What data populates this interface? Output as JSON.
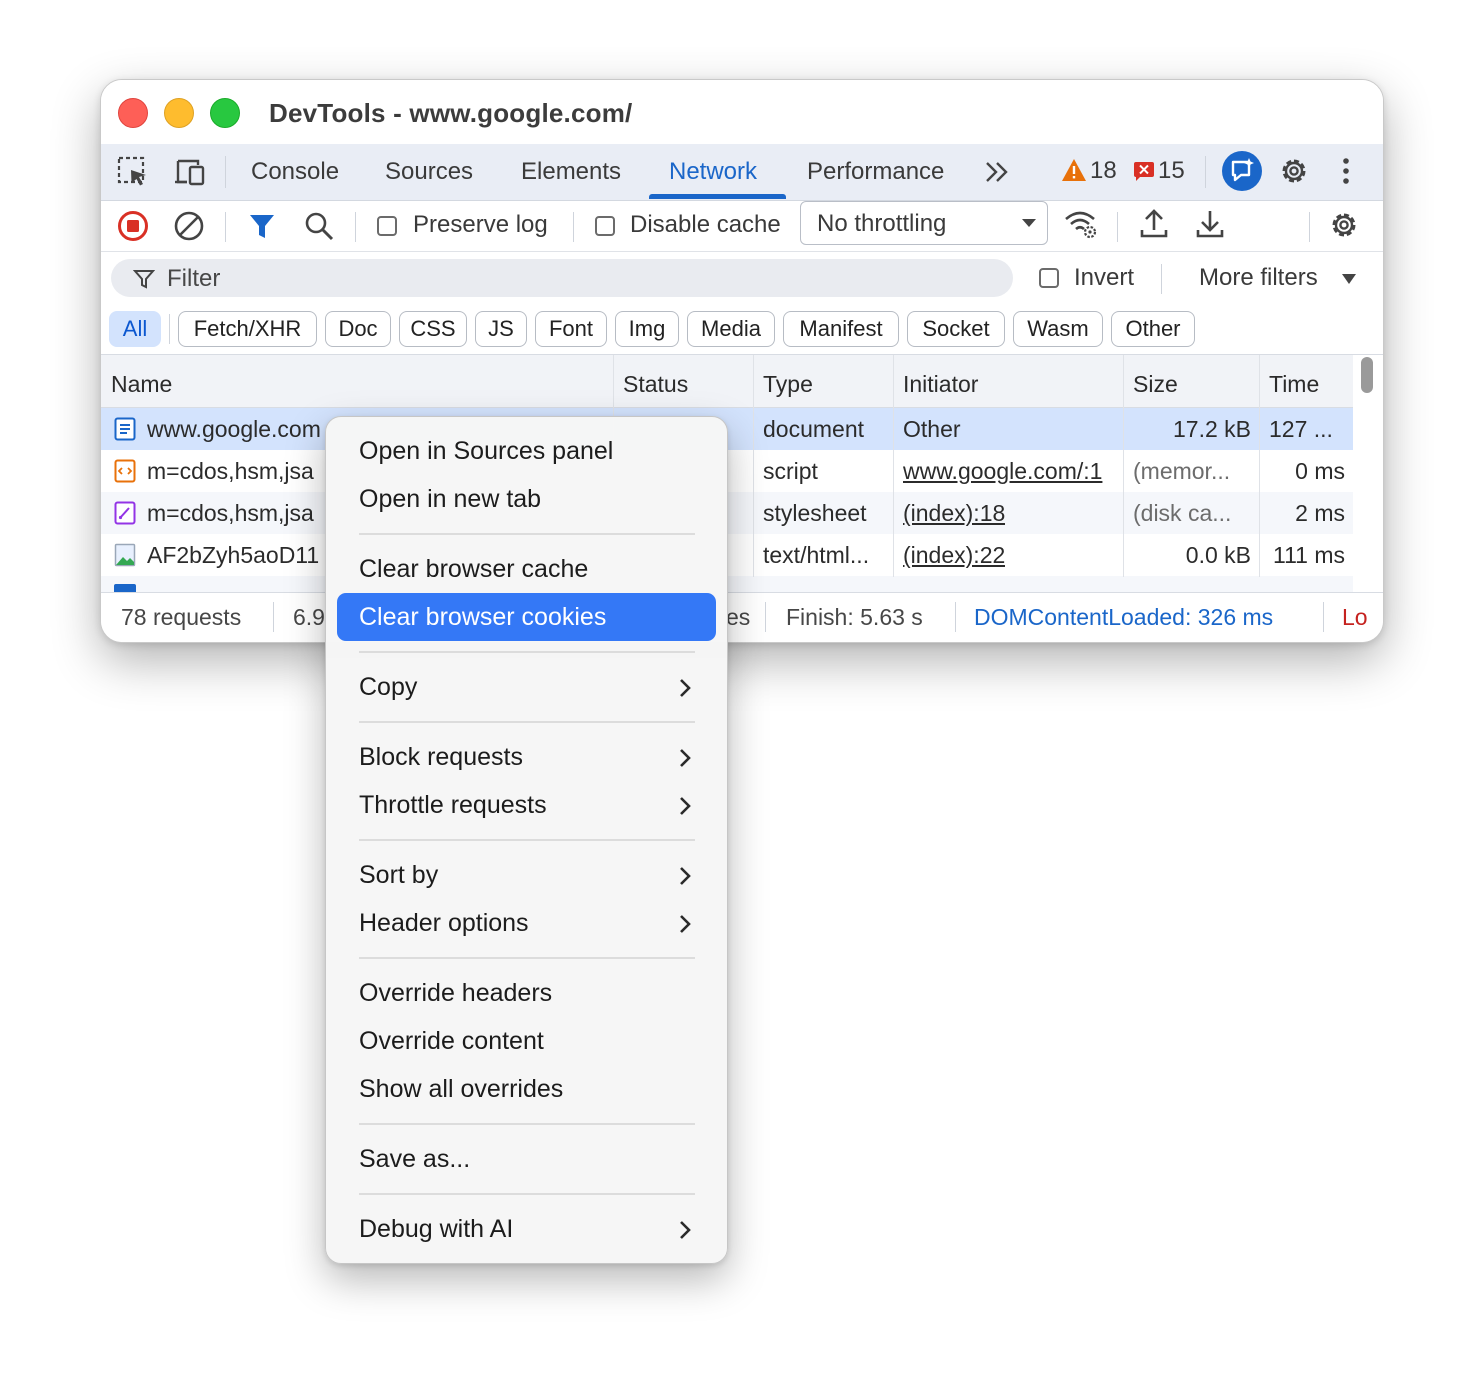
{
  "window": {
    "title": "DevTools - www.google.com/"
  },
  "colors": {
    "accent": "#1a66c9",
    "highlight": "#3478f6",
    "traffic_red": "#fe5f57",
    "traffic_yellow": "#febc2e",
    "traffic_green": "#28c840",
    "warning": "#e8710a",
    "error": "#d93025"
  },
  "tabs": {
    "items": [
      "Console",
      "Sources",
      "Elements",
      "Network",
      "Performance"
    ],
    "active": "Network",
    "warnings_count": "18",
    "errors_count": "15"
  },
  "toolbar": {
    "preserve_log": "Preserve log",
    "disable_cache": "Disable cache",
    "throttling": "No throttling"
  },
  "filter": {
    "placeholder": "Filter",
    "invert": "Invert",
    "more_filters": "More filters",
    "chips": [
      "All",
      "Fetch/XHR",
      "Doc",
      "CSS",
      "JS",
      "Font",
      "Img",
      "Media",
      "Manifest",
      "Socket",
      "Wasm",
      "Other"
    ]
  },
  "table": {
    "columns": [
      "Name",
      "Status",
      "Type",
      "Initiator",
      "Size",
      "Time"
    ],
    "rows": [
      {
        "name": "www.google.com",
        "type": "document",
        "initiator": "Other",
        "size": "17.2 kB",
        "time": "127 ..."
      },
      {
        "name": "m=cdos,hsm,jsa",
        "type": "script",
        "initiator": "www.google.com/:1",
        "size": "(memor...",
        "time": "0 ms"
      },
      {
        "name": "m=cdos,hsm,jsa",
        "type": "stylesheet",
        "initiator": "(index):18",
        "size": "(disk ca...",
        "time": "2 ms"
      },
      {
        "name": "AF2bZyh5aoD11",
        "type": "text/html...",
        "initiator": "(index):22",
        "size": "0.0 kB",
        "time": "111 ms"
      }
    ]
  },
  "status": {
    "requests": "78 requests",
    "transferred": "6.9",
    "resources_tail": "es",
    "finish": "Finish: 5.63 s",
    "dom_content_loaded": "DOMContentLoaded: 326 ms",
    "load": "Lo"
  },
  "context_menu": {
    "open_sources": "Open in Sources panel",
    "open_new_tab": "Open in new tab",
    "clear_cache": "Clear browser cache",
    "clear_cookies": "Clear browser cookies",
    "copy": "Copy",
    "block_requests": "Block requests",
    "throttle_requests": "Throttle requests",
    "sort_by": "Sort by",
    "header_options": "Header options",
    "override_headers": "Override headers",
    "override_content": "Override content",
    "show_overrides": "Show all overrides",
    "save_as": "Save as...",
    "debug_ai": "Debug with AI"
  }
}
